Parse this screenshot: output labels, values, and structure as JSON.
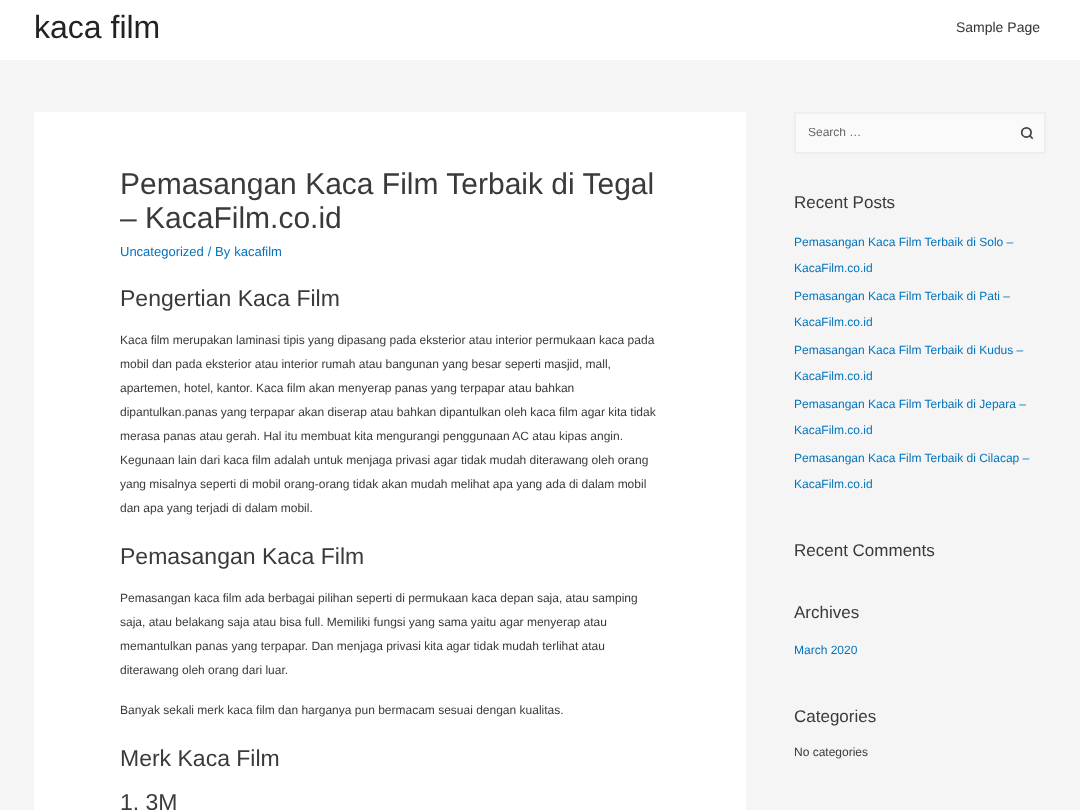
{
  "site_title": "kaca film",
  "nav": [
    {
      "label": "Sample Page"
    }
  ],
  "article": {
    "title": "Pemasangan Kaca Film Terbaik di Tegal – KacaFilm.co.id",
    "meta": {
      "category": "Uncategorized",
      "separator": "/ By",
      "author": "kacafilm"
    },
    "blocks": [
      {
        "kind": "heading",
        "text": "Pengertian Kaca Film"
      },
      {
        "kind": "paragraph",
        "text": "Kaca film merupakan laminasi tipis yang dipasang pada eksterior atau interior permukaan kaca pada mobil dan pada eksterior atau interior rumah atau bangunan yang besar seperti masjid, mall, apartemen, hotel, kantor. Kaca film akan menyerap panas yang terpapar atau bahkan dipantulkan.panas yang terpapar akan diserap atau bahkan dipantulkan oleh kaca film agar kita tidak merasa panas atau gerah. Hal itu membuat kita mengurangi penggunaan AC atau kipas angin. Kegunaan lain dari kaca film adalah untuk menjaga privasi agar tidak mudah diterawang oleh orang yang misalnya seperti di mobil orang-orang tidak akan mudah melihat apa yang ada di dalam mobil dan apa yang terjadi di dalam mobil."
      },
      {
        "kind": "heading",
        "text": "Pemasangan Kaca Film"
      },
      {
        "kind": "paragraph",
        "text": "Pemasangan kaca film ada berbagai pilihan seperti di permukaan kaca depan saja, atau samping saja, atau belakang saja atau bisa full. Memiliki fungsi yang sama yaitu agar menyerap atau memantulkan panas yang terpapar. Dan menjaga privasi kita agar tidak mudah terlihat atau diterawang oleh orang dari luar."
      },
      {
        "kind": "paragraph",
        "text": "Banyak sekali merk kaca film dan harganya pun bermacam sesuai dengan kualitas."
      },
      {
        "kind": "heading",
        "text": "Merk Kaca Film"
      },
      {
        "kind": "subheading",
        "text": "1. 3M"
      }
    ]
  },
  "sidebar": {
    "search": {
      "placeholder": "Search …"
    },
    "widgets": [
      {
        "title": "Recent Posts",
        "kind": "links",
        "items": [
          "Pemasangan Kaca Film Terbaik di Solo – KacaFilm.co.id",
          "Pemasangan Kaca Film Terbaik di Pati – KacaFilm.co.id",
          "Pemasangan Kaca Film Terbaik di Kudus – KacaFilm.co.id",
          "Pemasangan Kaca Film Terbaik di Jepara – KacaFilm.co.id",
          "Pemasangan Kaca Film Terbaik di Cilacap – KacaFilm.co.id"
        ]
      },
      {
        "title": "Recent Comments"
      },
      {
        "title": "Archives",
        "kind": "links",
        "items": [
          "March 2020"
        ]
      },
      {
        "title": "Categories",
        "kind": "text",
        "items": [
          "No categories"
        ]
      }
    ]
  }
}
